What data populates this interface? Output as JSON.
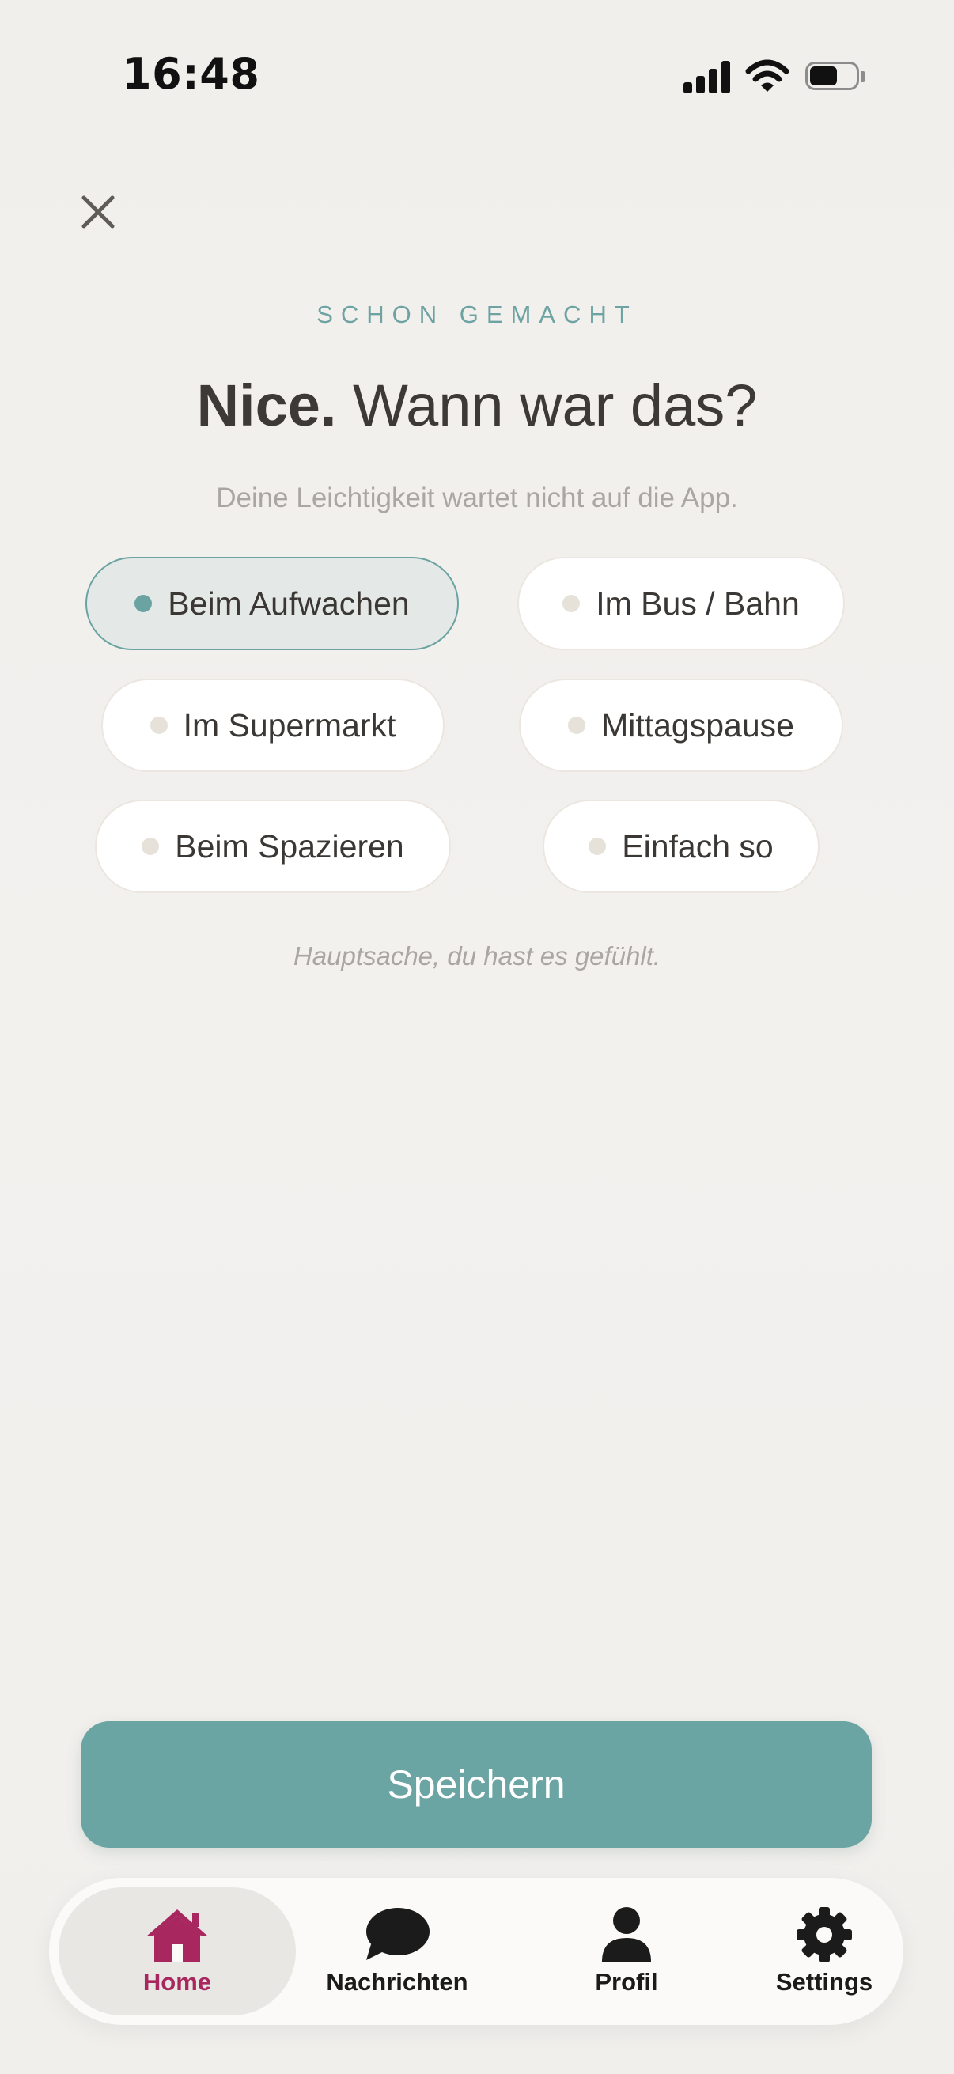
{
  "status_bar": {
    "time": "16:48"
  },
  "header": {
    "eyebrow": "SCHON GEMACHT",
    "title_bold": "Nice.",
    "title_rest": " Wann war das?",
    "subtitle": "Deine Leichtigkeit wartet nicht auf die App."
  },
  "options": {
    "items": [
      {
        "label": "Beim Aufwachen",
        "selected": true
      },
      {
        "label": "Im Bus / Bahn",
        "selected": false
      },
      {
        "label": "Im Supermarkt",
        "selected": false
      },
      {
        "label": "Mittagspause",
        "selected": false
      },
      {
        "label": "Beim Spazieren",
        "selected": false
      },
      {
        "label": "Einfach so",
        "selected": false
      }
    ]
  },
  "hint": "Hauptsache, du hast es gefühlt.",
  "save_button": {
    "label": "Speichern"
  },
  "tabbar": {
    "items": [
      {
        "label": "Home",
        "icon": "home-icon",
        "active": true
      },
      {
        "label": "Nachrichten",
        "icon": "chat-bubble-icon",
        "active": false
      },
      {
        "label": "Profil",
        "icon": "person-icon",
        "active": false
      },
      {
        "label": "Settings",
        "icon": "gear-icon",
        "active": false
      }
    ]
  },
  "colors": {
    "accent": "#6aa4a3",
    "active_tab": "#a8275e",
    "background": "#f2f0ed"
  }
}
